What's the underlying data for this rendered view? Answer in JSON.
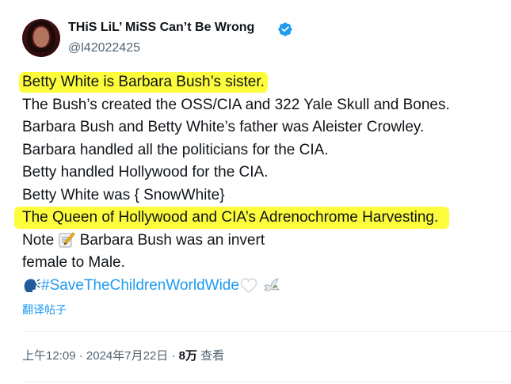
{
  "author": {
    "display_name": "THiS LiL’ MiSS Can’t Be Wrong",
    "handle": "@l42022425",
    "verified": true,
    "verified_color": "#1d9bf0"
  },
  "post": {
    "lines": [
      "Betty White is Barbara Bush’s sister.",
      "The Bush’s created the OSS/CIA and 322 Yale Skull and Bones.",
      "Barbara Bush and Betty White’s father was Aleister Crowley.",
      "Barbara handled all the politicians for the CIA.",
      "Betty handled Hollywood for the CIA.",
      "Betty White was { SnowWhite}",
      "The Queen of Hollywood and CIA’s Adrenochrome Harvesting.",
      "Barbara Bush was an invert",
      "female to Male."
    ],
    "note_prefix": "Note",
    "hashtag": "#SaveTheChildrenWorldWide",
    "highlight_color": "#fdfd3c",
    "icons": [
      "memo-icon",
      "speaking-head-icon",
      "white-heart-icon",
      "dove-icon"
    ]
  },
  "translate_label": "翻译帖子",
  "meta": {
    "time": "上午12:09",
    "date": "2024年7月22日",
    "views_count": "8万",
    "views_label": "查看"
  }
}
